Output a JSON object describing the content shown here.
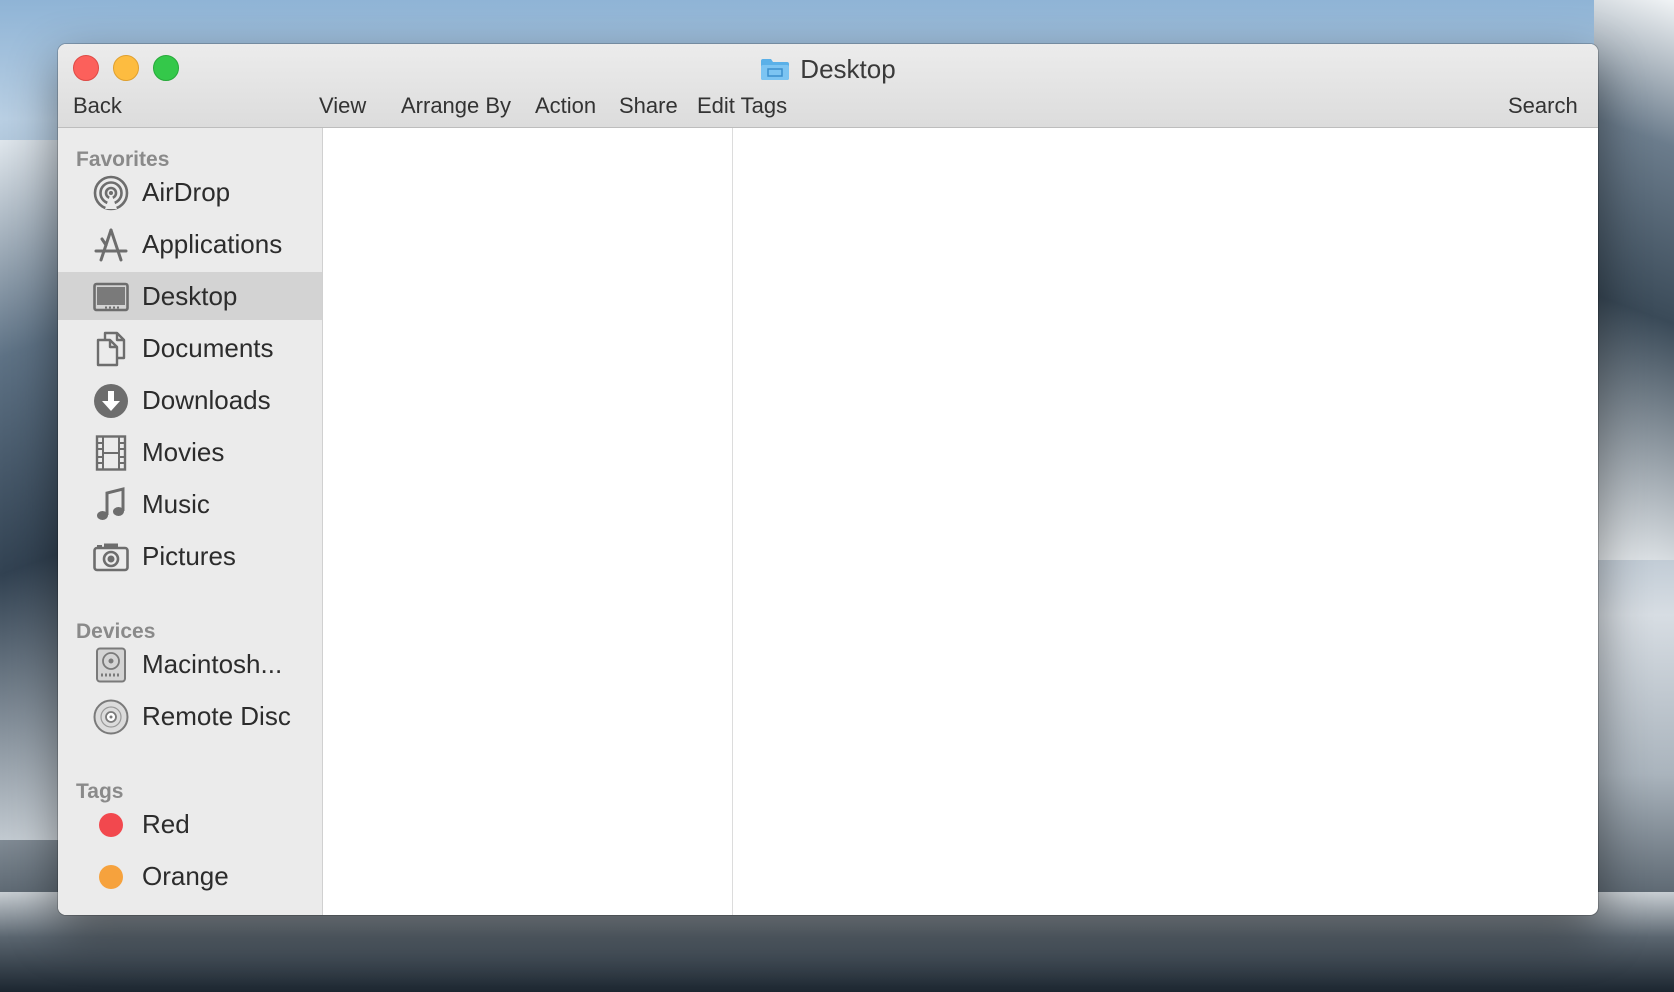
{
  "window": {
    "title": "Desktop"
  },
  "toolbar": {
    "back": "Back",
    "view": "View",
    "arrange_by": "Arrange By",
    "action": "Action",
    "share": "Share",
    "edit_tags": "Edit Tags",
    "search": "Search"
  },
  "sidebar": {
    "favorites_header": "Favorites",
    "favorites": [
      {
        "label": "AirDrop",
        "icon": "airdrop-icon"
      },
      {
        "label": "Applications",
        "icon": "applications-icon"
      },
      {
        "label": "Desktop",
        "icon": "desktop-icon",
        "selected": true
      },
      {
        "label": "Documents",
        "icon": "documents-icon"
      },
      {
        "label": "Downloads",
        "icon": "downloads-icon"
      },
      {
        "label": "Movies",
        "icon": "movies-icon"
      },
      {
        "label": "Music",
        "icon": "music-icon"
      },
      {
        "label": "Pictures",
        "icon": "pictures-icon"
      }
    ],
    "devices_header": "Devices",
    "devices": [
      {
        "label": "Macintosh...",
        "icon": "hard-drive-icon"
      },
      {
        "label": "Remote Disc",
        "icon": "remote-disc-icon"
      }
    ],
    "tags_header": "Tags",
    "tags": [
      {
        "label": "Red",
        "color": "#f2484e"
      },
      {
        "label": "Orange",
        "color": "#f6a23d"
      }
    ]
  },
  "colors": {
    "title_folder": "#5ab0e8",
    "selected_row": "#d3d3d3",
    "icon_gray": "#6d6d6d"
  }
}
